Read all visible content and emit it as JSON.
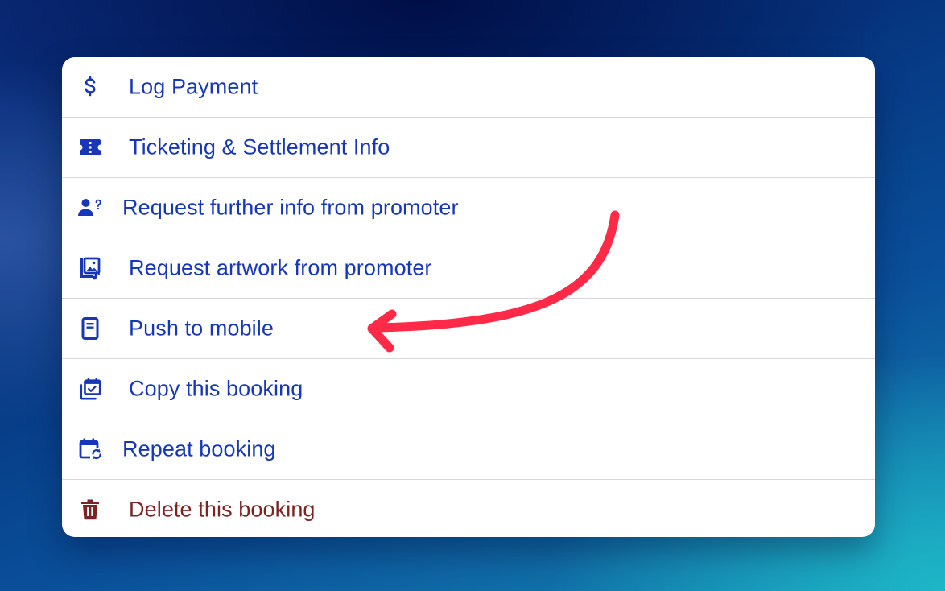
{
  "menu": {
    "items": [
      {
        "label": "Log Payment",
        "icon": "dollar-icon"
      },
      {
        "label": "Ticketing & Settlement Info",
        "icon": "ticket-icon"
      },
      {
        "label": "Request further info from promoter",
        "icon": "person-question-icon"
      },
      {
        "label": "Request artwork from promoter",
        "icon": "artwork-icon"
      },
      {
        "label": "Push to mobile",
        "icon": "mobile-icon"
      },
      {
        "label": "Copy this booking",
        "icon": "copy-calendar-icon"
      },
      {
        "label": "Repeat booking",
        "icon": "repeat-calendar-icon"
      },
      {
        "label": "Delete this booking",
        "icon": "trash-icon"
      }
    ]
  },
  "colors": {
    "item_text": "#1737b8",
    "danger_text": "#7b2424",
    "arrow": "#ff2a47"
  }
}
